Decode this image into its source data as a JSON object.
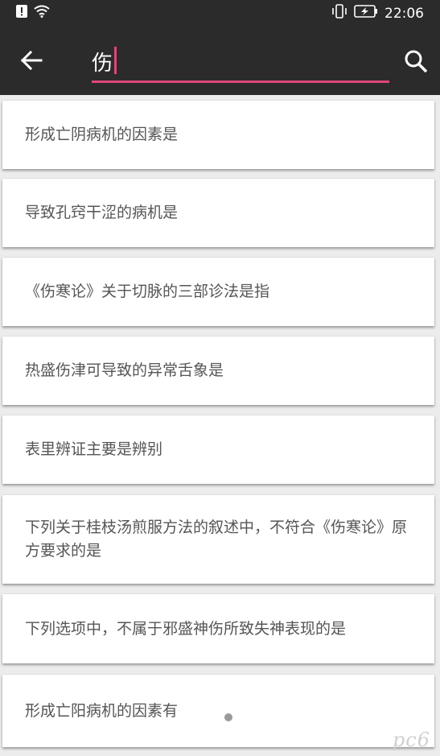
{
  "status_bar": {
    "time": "22:06",
    "icons": [
      "alert-icon",
      "wifi-icon",
      "vibrate-icon",
      "battery-charging-icon"
    ]
  },
  "toolbar": {
    "back_icon": "arrow-left-icon",
    "search_value": "伤",
    "search_icon": "search-icon",
    "accent_color": "#e0457b",
    "background_color": "#2b2b2b"
  },
  "results": [
    {
      "text": "形成亡阴病机的因素是"
    },
    {
      "text": "导致孔窍干涩的病机是"
    },
    {
      "text": "《伤寒论》关于切脉的三部诊法是指"
    },
    {
      "text": "热盛伤津可导致的异常舌象是"
    },
    {
      "text": "表里辨证主要是辨别"
    },
    {
      "text": "下列关于桂枝汤煎服方法的叙述中，不符合《伤寒论》原方要求的是"
    },
    {
      "text": "下列选项中，不属于邪盛神伤所致失神表现的是"
    },
    {
      "text": "形成亡阳病机的因素有"
    }
  ],
  "watermark": "pc6"
}
